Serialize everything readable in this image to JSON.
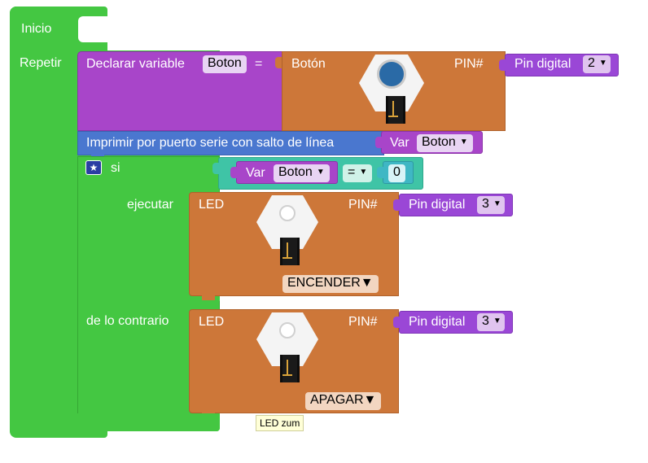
{
  "inicio_block": {
    "label": "Inicio"
  },
  "repetir_block": {
    "label": "Repetir"
  },
  "declarar_block": {
    "label": "Declarar variable",
    "var_name": "Boton",
    "equals": "="
  },
  "boton_block": {
    "label": "Botón",
    "pin_label": "PIN#",
    "pin_block_label": "Pin digital",
    "pin_value": "2"
  },
  "imprimir_block": {
    "label": "Imprimir por puerto serie con salto de línea",
    "var_prefix": "Var",
    "var_name": "Boton"
  },
  "si_block": {
    "label": "si",
    "ejecutar_label": "ejecutar",
    "contrario_label": "de lo contrario",
    "condition": {
      "var_prefix": "Var",
      "var_name": "Boton",
      "operator": "=",
      "value": "0"
    }
  },
  "led_on_block": {
    "label": "LED",
    "pin_label": "PIN#",
    "pin_block_label": "Pin digital",
    "pin_value": "3",
    "state": "ENCENDER"
  },
  "led_off_block": {
    "label": "LED",
    "pin_label": "PIN#",
    "pin_block_label": "Pin digital",
    "pin_value": "3",
    "state": "APAGAR"
  },
  "tooltip": {
    "text": "LED zum"
  },
  "colors": {
    "loop_green": "#44c742",
    "variable_purple": "#a845c9",
    "serial_blue": "#4a77cf",
    "component_orange": "#cd7739",
    "pin_violet": "#9a47d6",
    "logic_teal": "#3fc4a6"
  },
  "icons": {
    "mutator": "star-gear-icon",
    "dropdown": "triangle-down-icon",
    "button_module": "push-button-module-image",
    "led_module": "led-module-image"
  }
}
